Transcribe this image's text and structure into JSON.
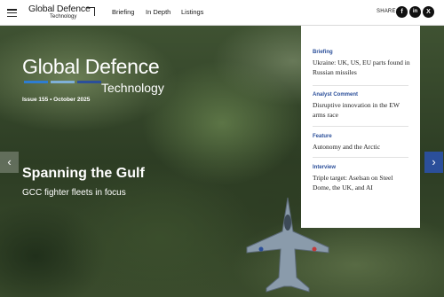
{
  "header": {
    "logo_line1": "Global Defence",
    "logo_line2": "Technology",
    "nav": [
      "Briefing",
      "In Depth",
      "Listings"
    ],
    "share_label": "SHARE:",
    "share_icons": [
      {
        "name": "facebook-icon",
        "glyph": "f"
      },
      {
        "name": "linkedin-icon",
        "glyph": "in"
      },
      {
        "name": "x-icon",
        "glyph": "X"
      }
    ]
  },
  "hero": {
    "brand_line1": "Global Defence",
    "brand_line2": "Technology",
    "brand_bar_colors": [
      "#2e7dd1",
      "#7fb0d8",
      "#2b4f9a"
    ],
    "issue": "Issue 155 • October 2025",
    "headline": "Spanning the Gulf",
    "subheadline": "GCC fighter fleets in focus",
    "prev_arrow": "‹",
    "next_arrow": "›"
  },
  "panel": {
    "items": [
      {
        "category": "Briefing",
        "title": "Ukraine: UK, US, EU parts found in Russian missiles"
      },
      {
        "category": "Analyst Comment",
        "title": "Disruptive innovation in the EW arms race"
      },
      {
        "category": "Feature",
        "title": "Autonomy and the Arctic"
      },
      {
        "category": "Interview",
        "title": "Triple target: Aselsan on Steel Dome, the UK, and AI"
      }
    ]
  },
  "colors": {
    "accent_blue": "#2b4f9a",
    "topbar_bg": "#ffffff"
  }
}
